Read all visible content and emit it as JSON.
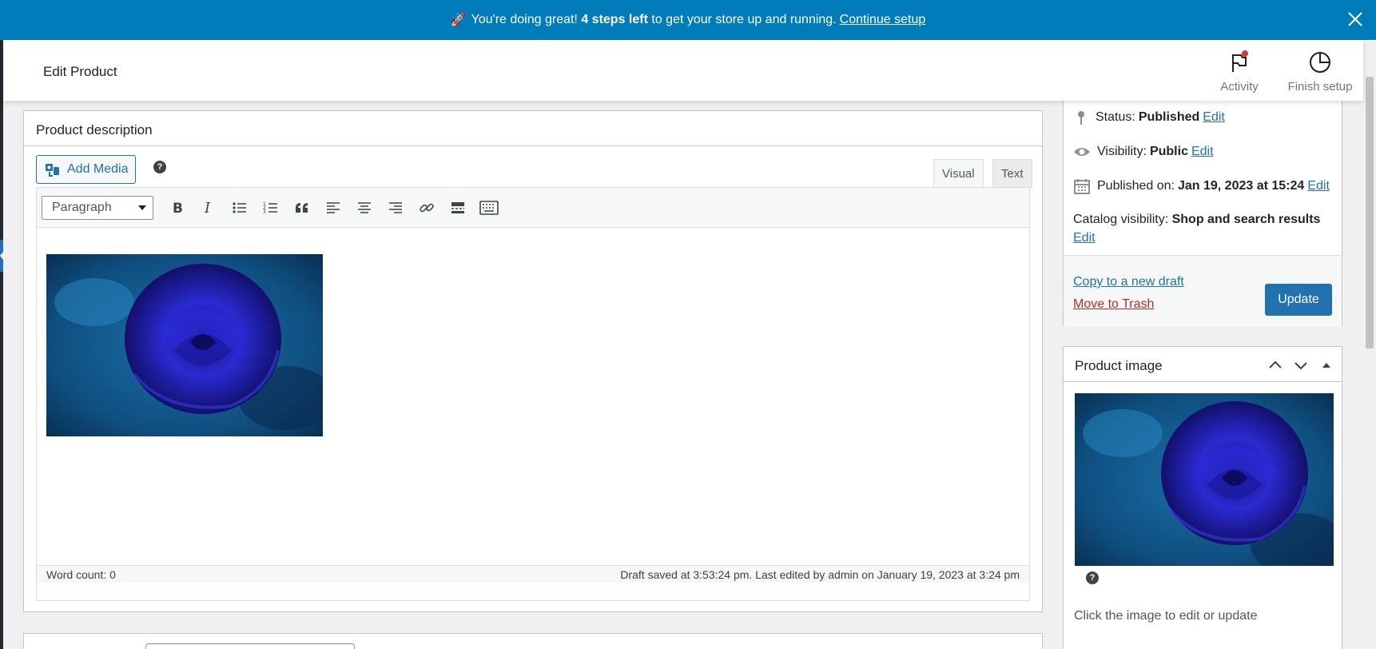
{
  "notice": {
    "message_pre": "You're doing great!",
    "message_bold": "4 steps left",
    "message_post": "to get your store up and running.",
    "link": "Continue setup"
  },
  "header": {
    "title": "Edit Product",
    "activity": "Activity",
    "finish_setup": "Finish setup"
  },
  "description": {
    "title": "Product description",
    "add_media": "Add Media",
    "help": "?",
    "tabs": {
      "visual": "Visual",
      "text": "Text"
    },
    "format_select": "Paragraph",
    "word_count": "Word count: 0",
    "draft_status": "Draft saved at 3:53:24 pm. Last edited by admin on January 19, 2023 at 3:24 pm"
  },
  "publish": {
    "status_label": "Status:",
    "status_value": "Published",
    "visibility_label": "Visibility:",
    "visibility_value": "Public",
    "published_label": "Published on:",
    "published_value": "Jan 19, 2023 at 15:24",
    "catalog_label": "Catalog visibility:",
    "catalog_value": "Shop and search results",
    "edit": "Edit",
    "copy_draft": "Copy to a new draft",
    "trash": "Move to Trash",
    "update": "Update"
  },
  "product_image": {
    "title": "Product image",
    "help": "?",
    "hint": "Click the image to edit or update"
  },
  "colors": {
    "notice_bg": "#007cba",
    "primary": "#2271b1",
    "danger": "#b32d2e"
  }
}
